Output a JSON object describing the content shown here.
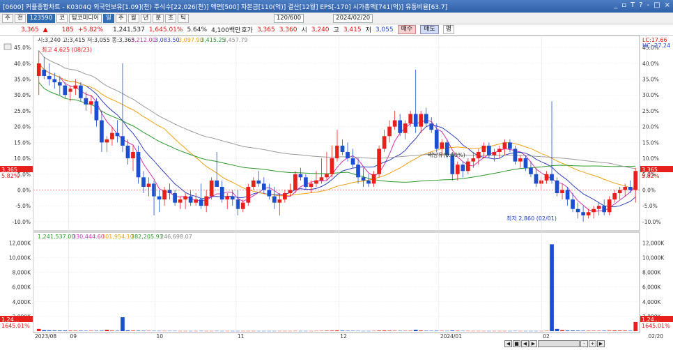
{
  "window": {
    "title": "[0600] 커플종합차트 - K0304Q 외국인보유[1.09](천) 주식수[22,026(천)] 액면[500] 자본금[110(억)] 결산[12월] EPS[-170] 시가총액[741(억)] 유통비율[63.7]",
    "controls": [
      "_",
      "▫",
      "T",
      "?",
      "-",
      "□",
      "×"
    ]
  },
  "toolbar1": {
    "items": [
      "주",
      "전",
      "123590",
      "코",
      "탑코미디어",
      "일",
      "주",
      "월",
      "년",
      "분",
      "초",
      "틱"
    ],
    "period_input": "120/600",
    "date_input": "2024/02/20"
  },
  "toolbar2": {
    "price": "3,365",
    "arrow": "▲",
    "change": "185",
    "change_pct": "+5.82%",
    "volume": "1,241,537",
    "vol_ratio": "1,645.01%",
    "turnover": "5.64%",
    "amount": "4,100백만",
    "ask_label": "호가",
    "ask": "3,365",
    "bid": "3,360",
    "open_label": "시",
    "open": "3,240",
    "high_label": "고",
    "high": "3,415",
    "low_label": "저",
    "low": "3,055",
    "buy": "매수",
    "sell": "매도",
    "flat": "평"
  },
  "price_legend": {
    "ohlc": "시:3,240 고:3,415 저:3,055 종:3,365",
    "ma1": "3,212.00",
    "ma2": "3,083.50",
    "ma3": "3,097.90",
    "ma4": "3,415.25",
    "ma5": "3,457.79"
  },
  "vol_legend": {
    "v": "1,241,537.00",
    "m1": "330,444.60",
    "m2": "301,954.10",
    "m3": "382,205.93",
    "m4": "246,698.07"
  },
  "annotations": {
    "high": "최고 4,625 (08/23)",
    "low": "최저 2,860 (02/01)",
    "mid": "배당유(0.00%)",
    "lc": "LC:17.66",
    "hc": "HC:-27.24",
    "price_tag": "3,365",
    "pct_tag": "5.82%",
    "vol_tag1": "1,24...",
    "vol_tag2": "1645.01%"
  },
  "colors": {
    "up": "#e8201c",
    "down": "#1b4fd0",
    "ma5": "#d42fb0",
    "ma20": "#2f3fbf",
    "ma60": "#f0a010",
    "ma120": "#2a9a2a",
    "ma240": "#999999",
    "vol": "#e8201c"
  },
  "x_labels": [
    "2023/08",
    "09",
    "10",
    "11",
    "12",
    "2024/01",
    "02",
    "02/20"
  ],
  "chart_data": {
    "type": "candlestick",
    "y_axis_label": "%",
    "yticks": [
      "45.0%",
      "40.0%",
      "35.0%",
      "30.0%",
      "25.0%",
      "20.0%",
      "15.0%",
      "10.0%",
      "5.0%",
      "0.0%",
      "-5.0%",
      "-10.0%"
    ],
    "ylim": [
      -12,
      47
    ],
    "vol_yticks": [
      "12,000K",
      "10,000K",
      "8,000K",
      "6,000K",
      "4,000K",
      "2,000K"
    ],
    "vol_ylim": [
      0,
      12500
    ],
    "candles": [
      [
        36,
        44,
        30,
        40
      ],
      [
        38,
        42,
        35,
        36
      ],
      [
        36,
        40,
        33,
        35
      ],
      [
        35,
        37,
        32,
        34
      ],
      [
        34,
        36,
        30,
        33
      ],
      [
        33,
        34,
        29,
        30
      ],
      [
        31,
        33,
        28,
        32
      ],
      [
        32,
        35,
        30,
        33
      ],
      [
        33,
        34,
        28,
        29
      ],
      [
        29,
        31,
        25,
        27
      ],
      [
        27,
        30,
        24,
        28
      ],
      [
        28,
        29,
        20,
        22
      ],
      [
        22,
        25,
        12,
        15
      ],
      [
        15,
        17,
        12,
        16
      ],
      [
        16,
        20,
        14,
        18
      ],
      [
        18,
        22,
        15,
        17
      ],
      [
        17,
        40,
        12,
        14
      ],
      [
        14,
        16,
        8,
        10
      ],
      [
        10,
        14,
        6,
        12
      ],
      [
        12,
        14,
        2,
        4
      ],
      [
        4,
        6,
        -1,
        1
      ],
      [
        1,
        4,
        -2,
        2
      ],
      [
        2,
        3,
        -8,
        -2
      ],
      [
        -2,
        0,
        -7,
        -3
      ],
      [
        -3,
        1,
        -5,
        0
      ],
      [
        0,
        2,
        -3,
        -1
      ],
      [
        -1,
        0,
        -5,
        -4
      ],
      [
        -4,
        -2,
        -6,
        -3
      ],
      [
        -3,
        -1,
        -6,
        -2
      ],
      [
        -2,
        0,
        -5,
        -4
      ],
      [
        -4,
        -1,
        -5,
        -3
      ],
      [
        -3,
        2,
        -6,
        -5
      ],
      [
        -5,
        0,
        -7,
        -2
      ],
      [
        -2,
        4,
        -3,
        3
      ],
      [
        3,
        12,
        2,
        1
      ],
      [
        1,
        3,
        -4,
        -3
      ],
      [
        -3,
        -1,
        -6,
        -2
      ],
      [
        -2,
        0,
        -5,
        -3
      ],
      [
        -3,
        0,
        -8,
        -6
      ],
      [
        -6,
        -3,
        -7,
        -4
      ],
      [
        -4,
        2,
        -5,
        1
      ],
      [
        1,
        4,
        0,
        3
      ],
      [
        3,
        6,
        1,
        2
      ],
      [
        2,
        4,
        -1,
        0
      ],
      [
        0,
        2,
        -3,
        -2
      ],
      [
        -2,
        1,
        -6,
        -4
      ],
      [
        -4,
        -1,
        -8,
        -3
      ],
      [
        -3,
        0,
        -4,
        -1
      ],
      [
        -1,
        2,
        -2,
        0
      ],
      [
        0,
        6,
        -1,
        5
      ],
      [
        5,
        7,
        3,
        4
      ],
      [
        4,
        5,
        0,
        1
      ],
      [
        1,
        3,
        -1,
        2
      ],
      [
        2,
        6,
        1,
        3
      ],
      [
        3,
        10,
        2,
        4
      ],
      [
        4,
        12,
        3,
        5
      ],
      [
        5,
        14,
        4,
        10
      ],
      [
        10,
        19,
        9,
        14
      ],
      [
        14,
        16,
        11,
        12
      ],
      [
        12,
        15,
        9,
        10
      ],
      [
        10,
        13,
        7,
        8
      ],
      [
        8,
        10,
        2,
        4
      ],
      [
        4,
        7,
        1,
        3
      ],
      [
        3,
        5,
        1,
        2
      ],
      [
        2,
        6,
        1,
        5
      ],
      [
        5,
        14,
        4,
        13
      ],
      [
        13,
        19,
        12,
        17
      ],
      [
        17,
        22,
        15,
        20
      ],
      [
        20,
        25,
        19,
        22
      ],
      [
        22,
        24,
        17,
        18
      ],
      [
        18,
        22,
        16,
        21
      ],
      [
        21,
        25,
        20,
        24
      ],
      [
        24,
        38,
        18,
        20
      ],
      [
        20,
        25,
        18,
        24
      ],
      [
        24,
        26,
        20,
        21
      ],
      [
        21,
        23,
        18,
        19
      ],
      [
        19,
        21,
        12,
        13
      ],
      [
        13,
        16,
        11,
        15
      ],
      [
        15,
        16,
        10,
        11
      ],
      [
        11,
        12,
        3,
        5
      ],
      [
        5,
        9,
        3,
        8
      ],
      [
        8,
        9,
        4,
        6
      ],
      [
        6,
        10,
        5,
        9
      ],
      [
        9,
        12,
        7,
        10
      ],
      [
        10,
        13,
        8,
        12
      ],
      [
        12,
        15,
        10,
        14
      ],
      [
        14,
        15,
        10,
        11
      ],
      [
        11,
        13,
        9,
        12
      ],
      [
        12,
        14,
        10,
        13
      ],
      [
        13,
        16,
        11,
        15
      ],
      [
        15,
        16,
        12,
        13
      ],
      [
        13,
        14,
        8,
        9
      ],
      [
        9,
        11,
        7,
        10
      ],
      [
        10,
        11,
        6,
        7
      ],
      [
        7,
        9,
        4,
        5
      ],
      [
        5,
        7,
        1,
        2
      ],
      [
        2,
        4,
        0,
        3
      ],
      [
        3,
        6,
        2,
        5
      ],
      [
        5,
        28,
        2,
        3
      ],
      [
        3,
        4,
        -2,
        -1
      ],
      [
        -1,
        2,
        -3,
        0
      ],
      [
        0,
        1,
        -5,
        -3
      ],
      [
        -3,
        -1,
        -7,
        -6
      ],
      [
        -6,
        -4,
        -9,
        -7
      ],
      [
        -7,
        -5,
        -10,
        -8
      ],
      [
        -8,
        -6,
        -9,
        -7
      ],
      [
        -7,
        -5,
        -9,
        -6
      ],
      [
        -6,
        -4,
        -8,
        -5
      ],
      [
        -5,
        -3,
        -8,
        -7
      ],
      [
        -7,
        -2,
        -8,
        -3
      ],
      [
        -3,
        0,
        -4,
        -1
      ],
      [
        -1,
        1,
        -3,
        0
      ],
      [
        0,
        2,
        -2,
        1
      ],
      [
        1,
        3,
        -1,
        0
      ],
      [
        0,
        7,
        -4,
        6
      ]
    ],
    "volumes": [
      300,
      150,
      120,
      100,
      100,
      90,
      80,
      70,
      70,
      60,
      60,
      60,
      70,
      200,
      80,
      60,
      1900,
      120,
      80,
      70,
      60,
      50,
      50,
      40,
      40,
      40,
      40,
      30,
      30,
      30,
      30,
      40,
      30,
      30,
      40,
      30,
      30,
      30,
      30,
      30,
      30,
      30,
      30,
      30,
      30,
      30,
      30,
      30,
      30,
      40,
      30,
      30,
      30,
      40,
      50,
      70,
      80,
      120,
      80,
      60,
      50,
      40,
      30,
      30,
      40,
      80,
      100,
      70,
      60,
      50,
      50,
      60,
      200,
      100,
      60,
      50,
      60,
      50,
      40,
      100,
      60,
      40,
      40,
      30,
      30,
      30,
      30,
      30,
      30,
      30,
      30,
      40,
      30,
      30,
      30,
      30,
      30,
      50,
      11800,
      300,
      150,
      100,
      100,
      80,
      70,
      60,
      60,
      60,
      70,
      80,
      100,
      90,
      80,
      60,
      1240
    ]
  }
}
